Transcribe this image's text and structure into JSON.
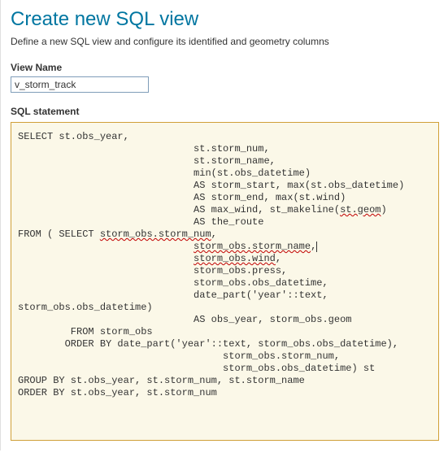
{
  "header": {
    "title": "Create new SQL view",
    "subtitle": "Define a new SQL view and configure its identified and geometry columns"
  },
  "form": {
    "view_name_label": "View Name",
    "view_name_value": "v_storm_track",
    "sql_label": "SQL statement"
  },
  "sql": {
    "l00": "SELECT st.obs_year,",
    "l01": "                              st.storm_num,",
    "l02": "                              st.storm_name,",
    "l03": "                              min(st.obs_datetime)",
    "l04": "                              AS storm_start, max(st.obs_datetime)",
    "l05": "                              AS storm_end, max(st.wind)",
    "l06a": "                              AS max_wind, st_makeline(",
    "l06b": "st.geom",
    "l06c": ")",
    "l07": "                              AS the_route",
    "l08a": "FROM ( SELECT ",
    "l08b": "storm_obs.storm_num",
    "l08c": ",",
    "l09a": "                              ",
    "l09b": "storm_obs.storm_name",
    "l09c": ",",
    "l10a": "                              ",
    "l10b": "storm_obs.wind",
    "l10c": ",",
    "l11": "                              storm_obs.press,",
    "l12": "                              storm_obs.obs_datetime,",
    "l13": "                              date_part('year'::text,",
    "l14": "storm_obs.obs_datetime)",
    "l15": "                              AS obs_year, storm_obs.geom",
    "l16": "         FROM storm_obs",
    "l17": "        ORDER BY date_part('year'::text, storm_obs.obs_datetime),",
    "l18": "                                   storm_obs.storm_num,",
    "l19": "                                   storm_obs.obs_datetime) st",
    "l20": "GROUP BY st.obs_year, st.storm_num, st.storm_name",
    "l21": "ORDER BY st.obs_year, st.storm_num"
  }
}
